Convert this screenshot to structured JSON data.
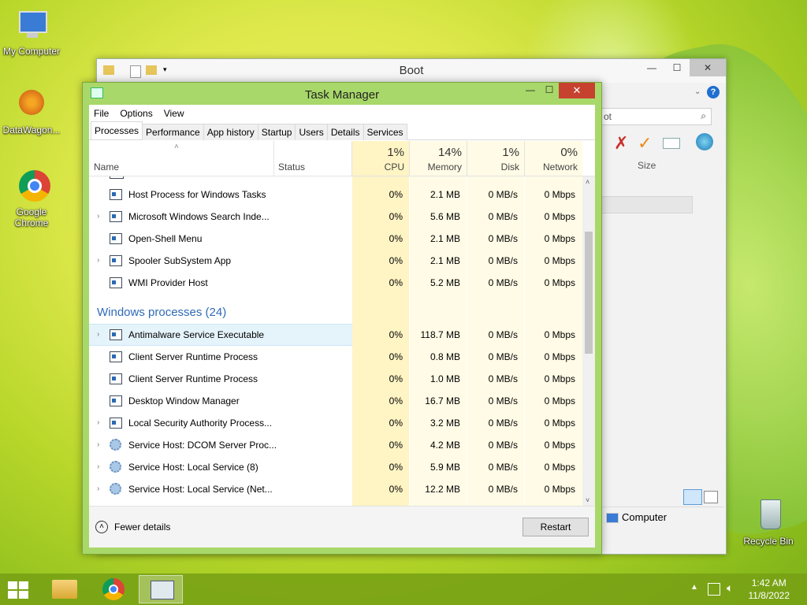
{
  "desktop": {
    "icons": [
      {
        "label": "My Computer"
      },
      {
        "label": "DataWagon..."
      },
      {
        "label": "Google Chrome"
      },
      {
        "label": "Recycle Bin"
      }
    ]
  },
  "explorer": {
    "title": "Boot",
    "search_placeholder": "ot",
    "column_size": "Size",
    "status_item": "Computer"
  },
  "task_manager": {
    "title": "Task Manager",
    "menu": [
      "File",
      "Options",
      "View"
    ],
    "tabs": [
      "Processes",
      "Performance",
      "App history",
      "Startup",
      "Users",
      "Details",
      "Services"
    ],
    "active_tab": "Processes",
    "columns": {
      "name": "Name",
      "status": "Status",
      "cpu": {
        "pct": "1%",
        "label": "CPU"
      },
      "memory": {
        "pct": "14%",
        "label": "Memory"
      },
      "disk": {
        "pct": "1%",
        "label": "Disk"
      },
      "network": {
        "pct": "0%",
        "label": "Network"
      }
    },
    "background_rows": [
      {
        "name": "Host Process for Windows Tasks",
        "cpu": "0%",
        "memory": "2.1 MB",
        "disk": "0 MB/s",
        "network": "0 Mbps",
        "expandable": false,
        "icon": "window-icon"
      },
      {
        "name": "Microsoft Windows Search Inde...",
        "cpu": "0%",
        "memory": "5.6 MB",
        "disk": "0 MB/s",
        "network": "0 Mbps",
        "expandable": true,
        "icon": "user-icon"
      },
      {
        "name": "Open-Shell Menu",
        "cpu": "0%",
        "memory": "2.1 MB",
        "disk": "0 MB/s",
        "network": "0 Mbps",
        "expandable": false,
        "icon": "shell-icon"
      },
      {
        "name": "Spooler SubSystem App",
        "cpu": "0%",
        "memory": "2.1 MB",
        "disk": "0 MB/s",
        "network": "0 Mbps",
        "expandable": true,
        "icon": "printer-icon"
      },
      {
        "name": "WMI Provider Host",
        "cpu": "0%",
        "memory": "5.2 MB",
        "disk": "0 MB/s",
        "network": "0 Mbps",
        "expandable": false,
        "icon": "wmi-icon"
      }
    ],
    "group_label": "Windows processes (24)",
    "windows_rows": [
      {
        "name": "Antimalware Service Executable",
        "cpu": "0%",
        "memory": "118.7 MB",
        "disk": "0 MB/s",
        "network": "0 Mbps",
        "expandable": true,
        "icon": "window-icon"
      },
      {
        "name": "Client Server Runtime Process",
        "cpu": "0%",
        "memory": "0.8 MB",
        "disk": "0 MB/s",
        "network": "0 Mbps",
        "expandable": false,
        "icon": "window-icon"
      },
      {
        "name": "Client Server Runtime Process",
        "cpu": "0%",
        "memory": "1.0 MB",
        "disk": "0 MB/s",
        "network": "0 Mbps",
        "expandable": false,
        "icon": "window-icon"
      },
      {
        "name": "Desktop Window Manager",
        "cpu": "0%",
        "memory": "16.7 MB",
        "disk": "0 MB/s",
        "network": "0 Mbps",
        "expandable": false,
        "icon": "window-icon"
      },
      {
        "name": "Local Security Authority Process...",
        "cpu": "0%",
        "memory": "3.2 MB",
        "disk": "0 MB/s",
        "network": "0 Mbps",
        "expandable": true,
        "icon": "window-icon"
      },
      {
        "name": "Service Host: DCOM Server Proc...",
        "cpu": "0%",
        "memory": "4.2 MB",
        "disk": "0 MB/s",
        "network": "0 Mbps",
        "expandable": true,
        "icon": "gear-icon"
      },
      {
        "name": "Service Host: Local Service (8)",
        "cpu": "0%",
        "memory": "5.9 MB",
        "disk": "0 MB/s",
        "network": "0 Mbps",
        "expandable": true,
        "icon": "gear-icon"
      },
      {
        "name": "Service Host: Local Service (Net...",
        "cpu": "0%",
        "memory": "12.2 MB",
        "disk": "0 MB/s",
        "network": "0 Mbps",
        "expandable": true,
        "icon": "gear-icon"
      }
    ],
    "fewer_details": "Fewer details",
    "restart": "Restart"
  },
  "taskbar": {
    "time": "1:42 AM",
    "date": "11/8/2022"
  },
  "colors": {
    "cpu_column_bg": "#fff4c4",
    "metric_column_bg": "#fffbe6",
    "selected_row_bg": "#e5f3fb",
    "group_text": "#2f6bb7",
    "close_button": "#c7412f"
  }
}
